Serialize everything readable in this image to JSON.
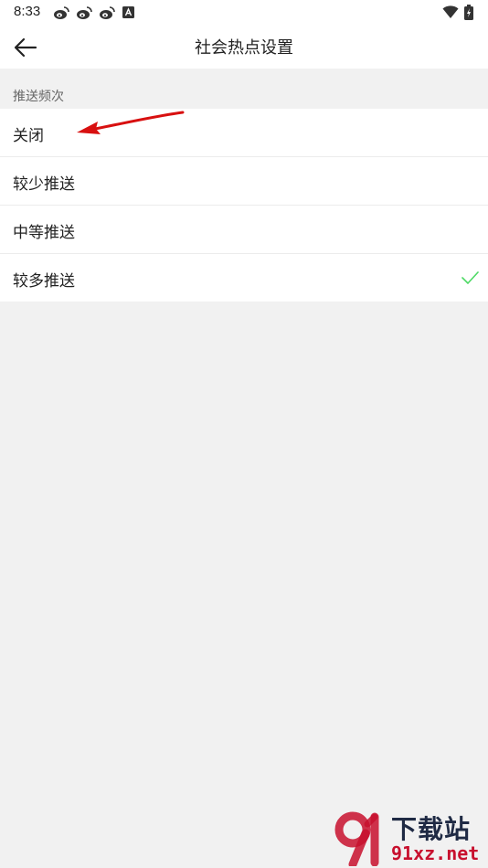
{
  "status_bar": {
    "time": "8:33",
    "icons": [
      "weibo-icon",
      "weibo-icon",
      "weibo-icon",
      "a-app-icon",
      "wifi-icon",
      "battery-icon"
    ]
  },
  "toolbar": {
    "back_icon": "arrow-left-icon",
    "title": "社会热点设置"
  },
  "section": {
    "header": "推送频次"
  },
  "options": [
    {
      "label": "关闭",
      "selected": false
    },
    {
      "label": "较少推送",
      "selected": false
    },
    {
      "label": "中等推送",
      "selected": false
    },
    {
      "label": "较多推送",
      "selected": true
    }
  ],
  "watermark": {
    "top_text": "下载站",
    "bottom_text": "91xz.net"
  },
  "colors": {
    "background": "#f1f1f1",
    "surface": "#ffffff",
    "check": "#4cd964",
    "annotation": "#d81010",
    "watermark_red": "#c8102e"
  }
}
